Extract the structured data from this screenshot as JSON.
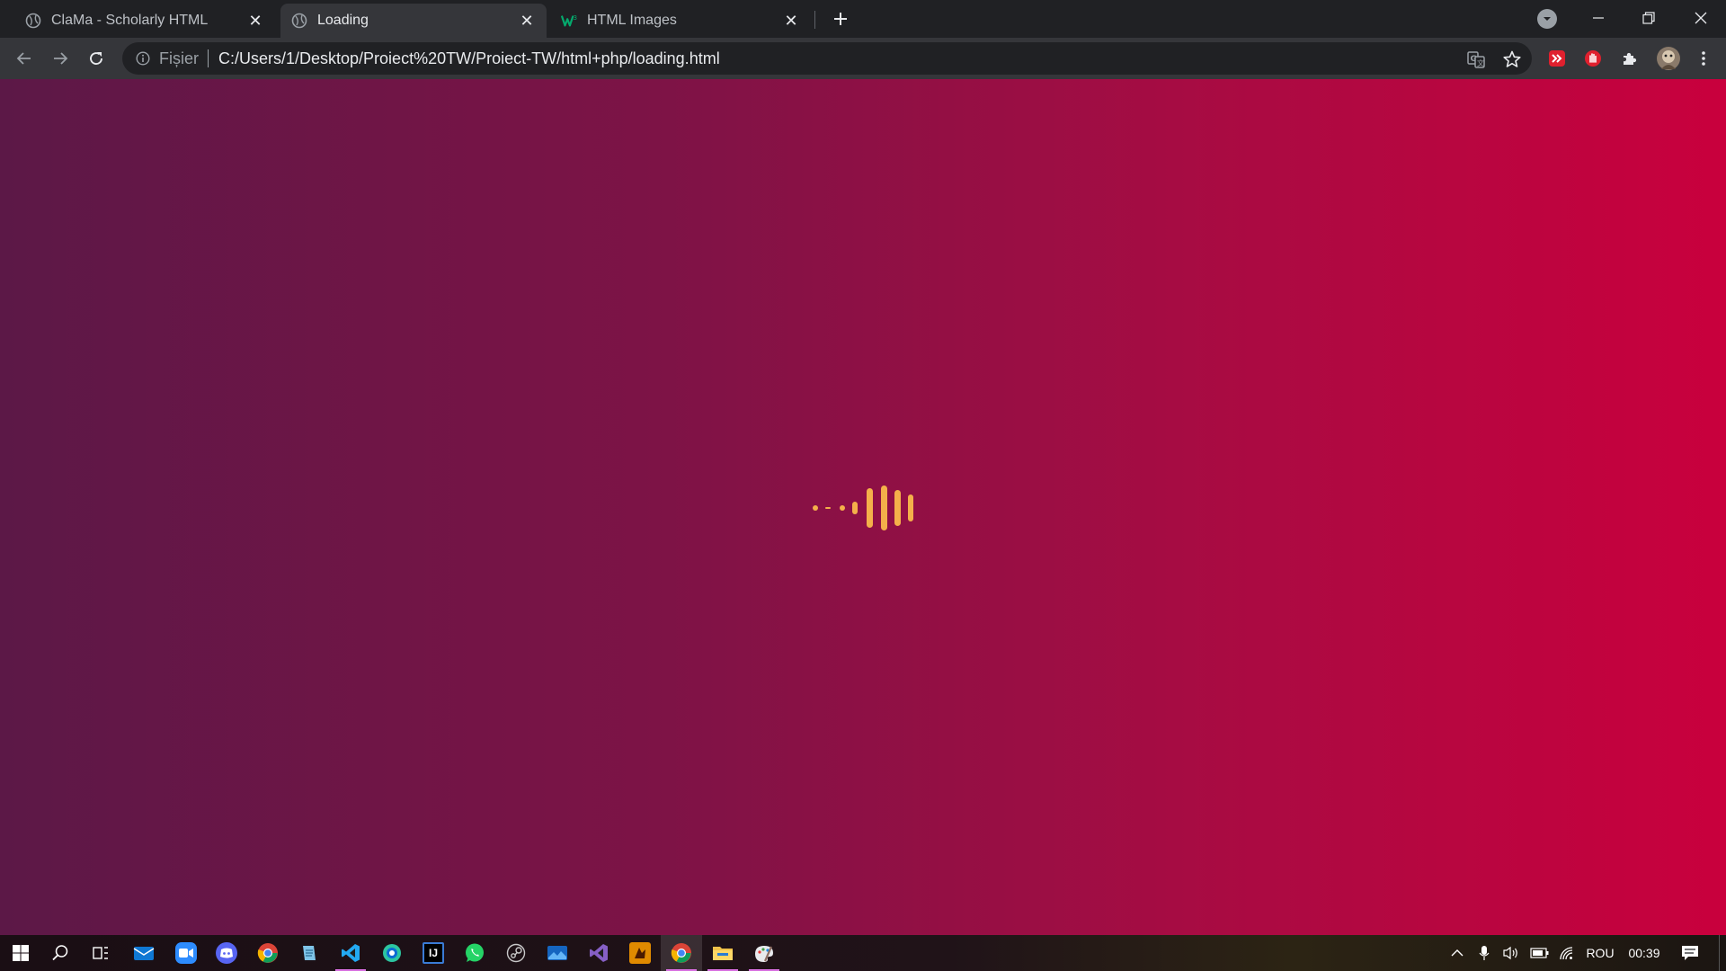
{
  "browser": {
    "tabs": [
      {
        "title": "ClaMa - Scholarly HTML",
        "favicon": "globe-icon",
        "active": false
      },
      {
        "title": "Loading",
        "favicon": "globe-icon",
        "active": true
      },
      {
        "title": "HTML Images",
        "favicon": "w3schools-icon",
        "active": false
      }
    ],
    "address_bar": {
      "security_chip": "Fișier",
      "url": "C:/Users/1/Desktop/Proiect%20TW/Proiect-TW/html+php/loading.html"
    },
    "extensions": [
      "translate-icon",
      "bookmark-star-icon",
      "extension-red-arrows-icon",
      "extension-red-hand-icon",
      "puzzle-icon",
      "profile-avatar-icon",
      "menu-dots-icon"
    ]
  },
  "page": {
    "background_colors": [
      "#5c1847",
      "#c9003d"
    ],
    "loader_color": "#f4b04a",
    "loader_icon": "audio-bars-loader-icon"
  },
  "taskbar": {
    "apps": [
      "start-icon",
      "search-icon",
      "task-view-icon",
      "mail-icon",
      "zoom-icon",
      "discord-icon",
      "chrome-icon",
      "notepad-icon",
      "vscode-icon",
      "edge-icon",
      "intellij-icon",
      "whatsapp-icon",
      "steam-icon",
      "photos-icon",
      "visual-studio-icon",
      "game-icon",
      "chrome-active-icon",
      "file-explorer-icon",
      "paint-icon"
    ],
    "tray": {
      "language": "ROU",
      "time": "00:39"
    }
  }
}
